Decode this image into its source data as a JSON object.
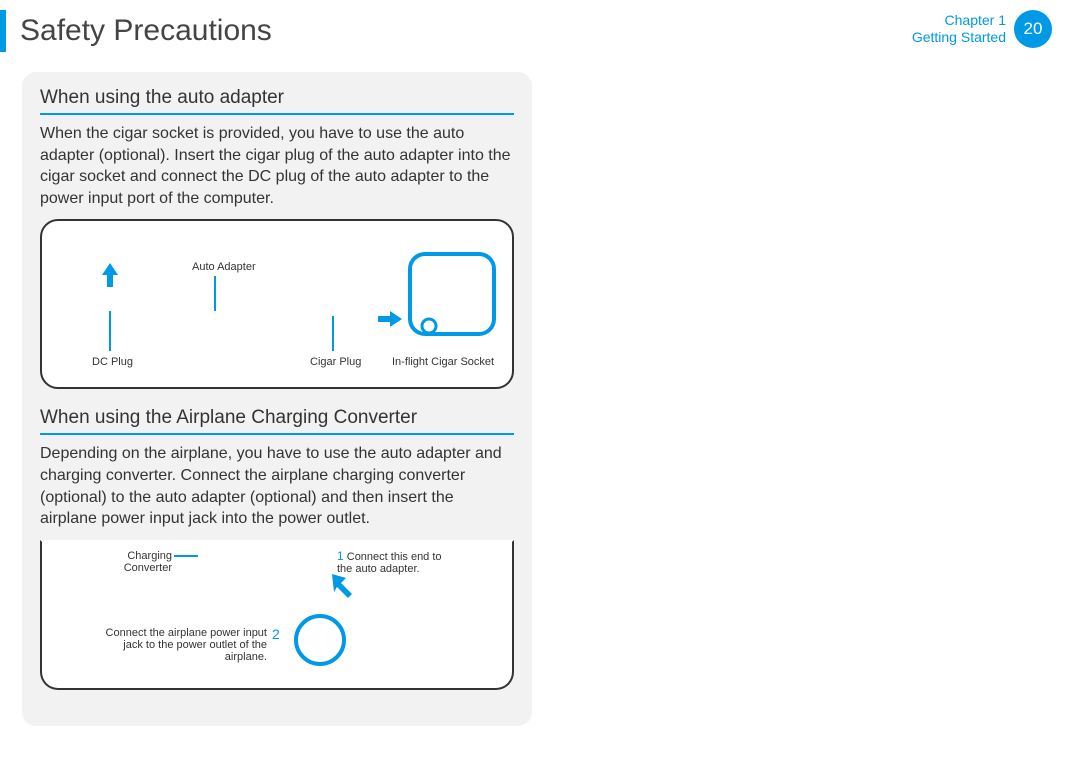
{
  "header": {
    "title": "Safety Precautions",
    "chapter_line1": "Chapter 1",
    "chapter_line2": "Getting Started",
    "page_number": "20"
  },
  "section1": {
    "heading": "When using the auto adapter",
    "body": "When the cigar socket is provided, you have to use the auto adapter (optional). Insert the cigar plug of the auto adapter into the cigar socket and connect the DC plug of the auto adapter to the power input port of the computer.",
    "labels": {
      "dc_plug": "DC Plug",
      "auto_adapter": "Auto Adapter",
      "cigar_plug": "Cigar Plug",
      "inflight_socket": "In-ﬂight Cigar Socket"
    }
  },
  "section2": {
    "heading": "When using the Airplane Charging Converter",
    "body": "Depending on the airplane, you have to use the auto adapter and charging converter. Connect the airplane charging converter (optional) to the auto adapter (optional) and then insert the airplane power input jack into the power outlet.",
    "labels": {
      "charging_converter": "Charging Converter",
      "step1_num": "1",
      "step1_text": "Connect this end to the auto adapter.",
      "step2_text": "Connect the airplane power input jack to the power outlet of the airplane.",
      "step2_num": "2"
    }
  }
}
